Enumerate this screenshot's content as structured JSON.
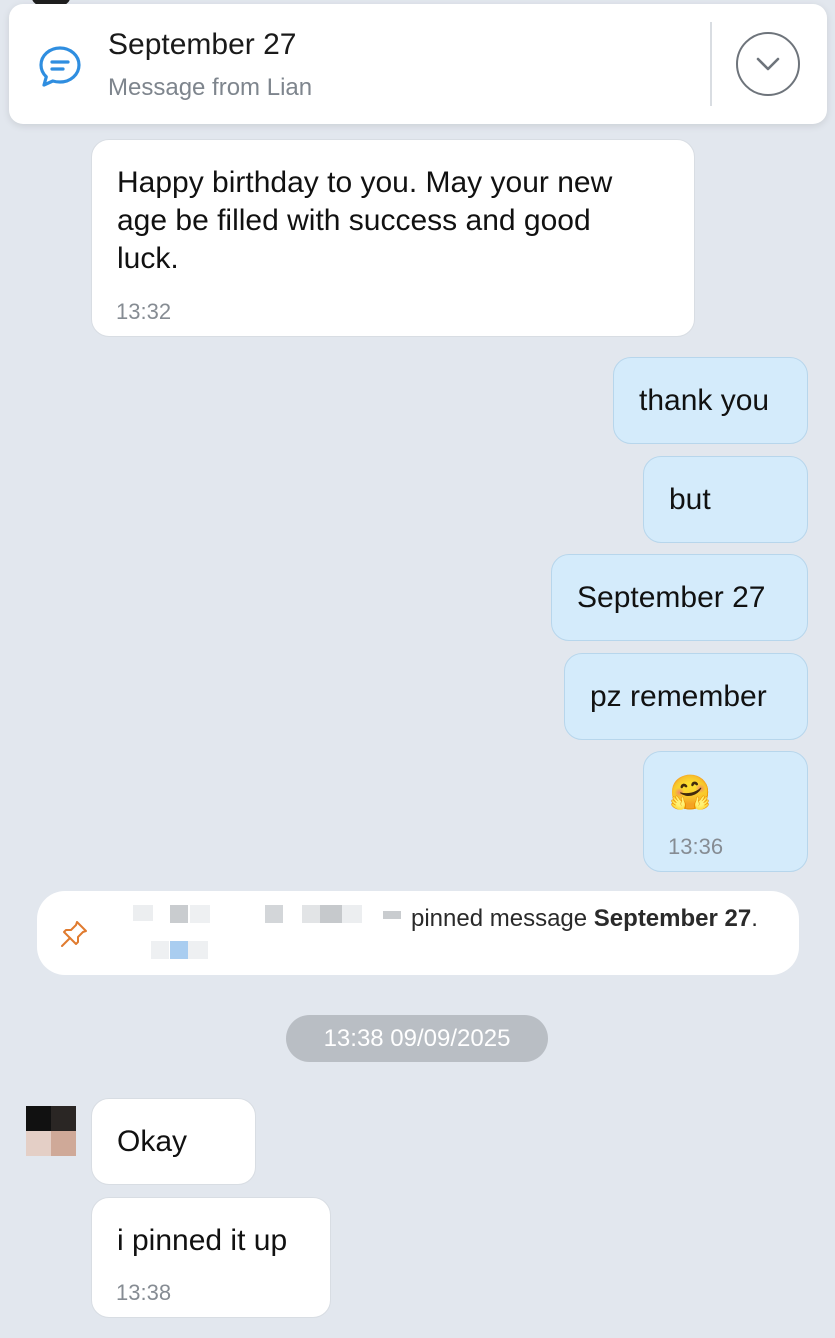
{
  "pinned_banner": {
    "title": "September 27",
    "subtitle": "Message from Lian"
  },
  "messages": [
    {
      "direction": "incoming",
      "text": "Happy birthday to you. May your new\nage be filled with success and good\nluck.",
      "time": "13:32"
    },
    {
      "direction": "outgoing",
      "text": "thank you"
    },
    {
      "direction": "outgoing",
      "text": "but"
    },
    {
      "direction": "outgoing",
      "text": "September 27"
    },
    {
      "direction": "outgoing",
      "text": "pz remember"
    },
    {
      "direction": "outgoing",
      "text": "🤗",
      "time": "13:36"
    },
    {
      "direction": "incoming",
      "text": "Okay"
    },
    {
      "direction": "incoming",
      "text": "i pinned it up",
      "time": "13:38"
    }
  ],
  "system_notice": {
    "text": "pinned message ",
    "highlight": "September 27",
    "suffix": "."
  },
  "date_separator": "13:38 09/09/2025",
  "colors": {
    "background": "#e2e7ee",
    "incoming_bubble": "#ffffff",
    "outgoing_bubble": "#d4ebfb",
    "accent": "#2f8ee0",
    "pin_icon": "#e07b2f"
  },
  "icons": {
    "banner": "chat-bubble-icon",
    "expand": "chevron-down-icon",
    "notice": "pin-icon"
  }
}
